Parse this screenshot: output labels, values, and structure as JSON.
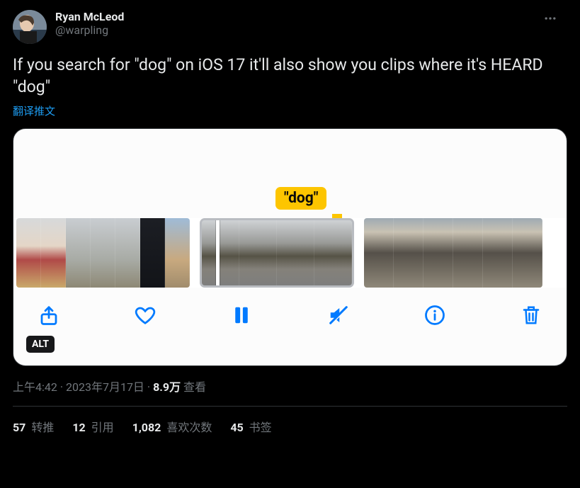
{
  "author": {
    "display_name": "Ryan McLeod",
    "username": "@warpling"
  },
  "tweet_text": "If you search for \"dog\" on iOS 17 it'll also show you clips where it's HEARD \"dog\"",
  "translate_label": "翻译推文",
  "dog_label": "\"dog\"",
  "alt_badge": "ALT",
  "meta": {
    "time": "上午4:42",
    "dot1": " · ",
    "date": "2023年7月17日",
    "dot2": " · ",
    "views_count": "8.9万",
    "views_label": " 查看"
  },
  "engagement": {
    "retweets_count": "57",
    "retweets_label": " 转推",
    "quotes_count": "12",
    "quotes_label": " 引用",
    "likes_count": "1,082",
    "likes_label": " 喜欢次数",
    "bookmarks_count": "45",
    "bookmarks_label": " 书签"
  },
  "icons": {
    "share": "share-icon",
    "heart": "heart-icon",
    "pause": "pause-icon",
    "mute": "mute-icon",
    "info": "info-icon",
    "trash": "trash-icon",
    "more": "more-icon"
  }
}
